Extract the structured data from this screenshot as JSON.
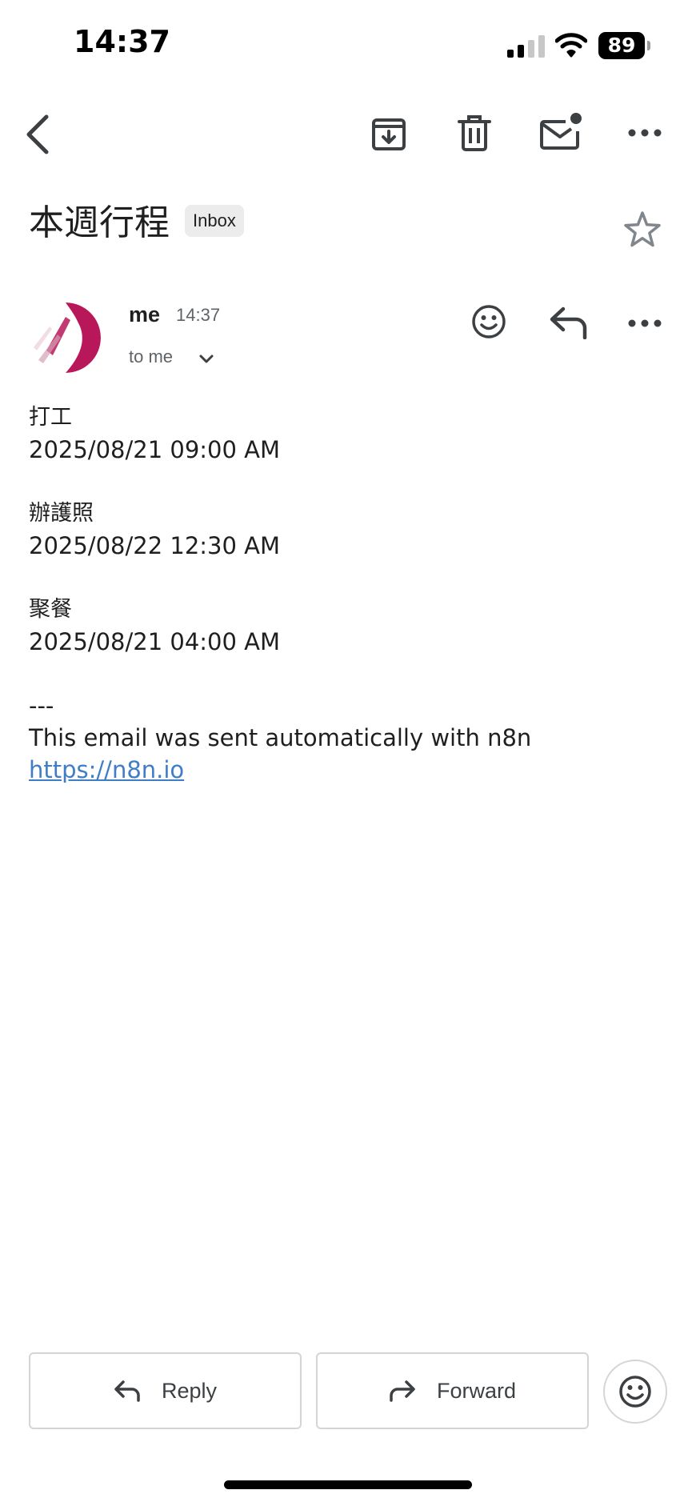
{
  "status_bar": {
    "time": "14:37",
    "battery_level": "89",
    "signal_icon": "cellular-signal-icon",
    "wifi_icon": "wifi-icon",
    "battery_icon": "battery-icon"
  },
  "toolbar": {
    "back_icon": "chevron-left-icon",
    "archive_icon": "archive-icon",
    "delete_icon": "trash-icon",
    "mark_unread_icon": "mail-unread-icon",
    "more_icon": "more-horizontal-icon"
  },
  "email": {
    "subject": "本週行程",
    "label": "Inbox",
    "starred": false,
    "sender": {
      "name": "me",
      "time": "14:37",
      "recipient_text": "to me"
    },
    "body": {
      "entries": [
        {
          "title": "打工",
          "datetime": "2025/08/21 09:00 AM"
        },
        {
          "title": "辦護照",
          "datetime": "2025/08/22 12:30 AM"
        },
        {
          "title": "聚餐",
          "datetime": "2025/08/21 04:00 AM"
        }
      ],
      "separator": "---",
      "footer_text": "This email was sent automatically with n8n",
      "footer_link": "https://n8n.io"
    }
  },
  "actions": {
    "reply_label": "Reply",
    "forward_label": "Forward"
  },
  "colors": {
    "link": "#3f7ec6",
    "avatar_accent": "#b8185a",
    "icon": "#5f6368"
  }
}
